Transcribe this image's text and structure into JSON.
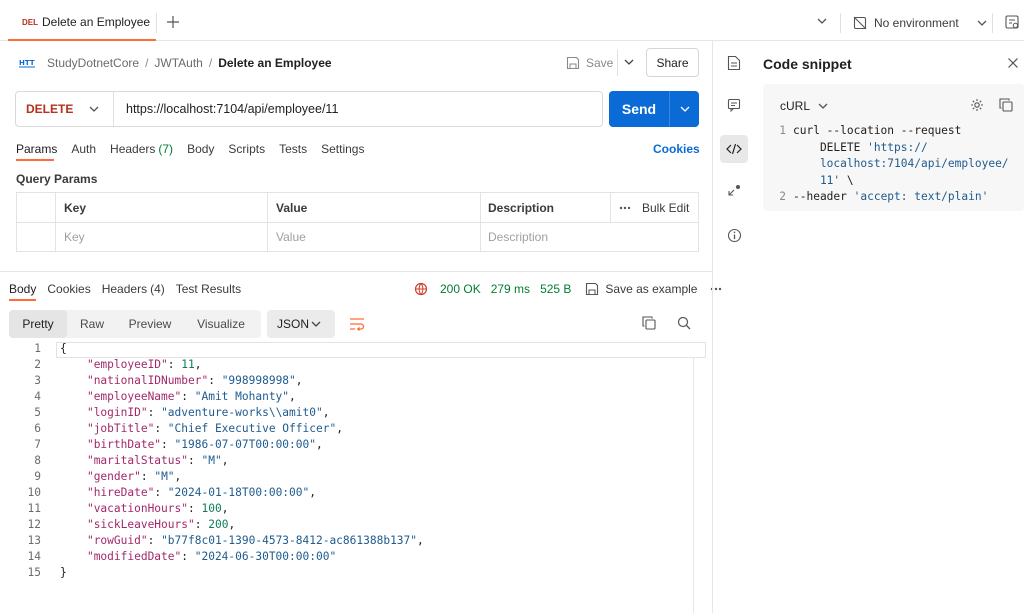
{
  "tab": {
    "method": "DEL",
    "title": "Delete an Employee"
  },
  "environment": {
    "label": "No environment"
  },
  "breadcrumb": {
    "collection": "StudyDotnetCore",
    "folder": "JWTAuth",
    "request": "Delete an Employee"
  },
  "actions": {
    "save": "Save",
    "share": "Share"
  },
  "request": {
    "method": "DELETE",
    "url": "https://localhost:7104/api/employee/11",
    "send": "Send"
  },
  "request_tabs": [
    {
      "label": "Params",
      "count": ""
    },
    {
      "label": "Auth",
      "count": ""
    },
    {
      "label": "Headers",
      "count": "(7)"
    },
    {
      "label": "Body",
      "count": ""
    },
    {
      "label": "Scripts",
      "count": ""
    },
    {
      "label": "Tests",
      "count": ""
    },
    {
      "label": "Settings",
      "count": ""
    }
  ],
  "cookies_link": "Cookies",
  "query_params": {
    "title": "Query Params",
    "headers": {
      "key": "Key",
      "value": "Value",
      "description": "Description",
      "bulk_edit": "Bulk Edit"
    },
    "placeholder": {
      "key": "Key",
      "value": "Value",
      "description": "Description"
    }
  },
  "response_tabs": [
    {
      "label": "Body",
      "count": ""
    },
    {
      "label": "Cookies",
      "count": ""
    },
    {
      "label": "Headers",
      "count": "(4)"
    },
    {
      "label": "Test Results",
      "count": ""
    }
  ],
  "response_meta": {
    "status": "200 OK",
    "time": "279 ms",
    "size": "525 B",
    "save_example": "Save as example"
  },
  "view_modes": [
    "Pretty",
    "Raw",
    "Preview",
    "Visualize"
  ],
  "format": "JSON",
  "response_body": [
    {
      "n": "1",
      "text": "{"
    },
    {
      "n": "2",
      "key": "employeeID",
      "val": "11",
      "kind": "num"
    },
    {
      "n": "3",
      "key": "nationalIDNumber",
      "val": "998998998",
      "kind": "str"
    },
    {
      "n": "4",
      "key": "employeeName",
      "val": "Amit Mohanty",
      "kind": "str"
    },
    {
      "n": "5",
      "key": "loginID",
      "val": "adventure-works\\\\amit0",
      "kind": "str"
    },
    {
      "n": "6",
      "key": "jobTitle",
      "val": "Chief Executive Officer",
      "kind": "str"
    },
    {
      "n": "7",
      "key": "birthDate",
      "val": "1986-07-07T00:00:00",
      "kind": "str"
    },
    {
      "n": "8",
      "key": "maritalStatus",
      "val": "M",
      "kind": "str"
    },
    {
      "n": "9",
      "key": "gender",
      "val": "M",
      "kind": "str"
    },
    {
      "n": "10",
      "key": "hireDate",
      "val": "2024-01-18T00:00:00",
      "kind": "str"
    },
    {
      "n": "11",
      "key": "vacationHours",
      "val": "100",
      "kind": "num"
    },
    {
      "n": "12",
      "key": "sickLeaveHours",
      "val": "200",
      "kind": "num"
    },
    {
      "n": "13",
      "key": "rowGuid",
      "val": "b77f8c01-1390-4573-8412-ac861388b137",
      "kind": "str"
    },
    {
      "n": "14",
      "key": "modifiedDate",
      "val": "2024-06-30T00:00:00",
      "kind": "str",
      "last": true
    },
    {
      "n": "15",
      "text": "}"
    }
  ],
  "code_snippet": {
    "title": "Code snippet",
    "language": "cURL",
    "lines": [
      {
        "n": "1",
        "plain": "curl --location --request"
      },
      {
        "n": "",
        "plain": "    DELETE ",
        "str": "'https://"
      },
      {
        "n": "",
        "str": "    localhost:7104/api/employee/"
      },
      {
        "n": "",
        "str": "    11'",
        "plain_after": " \\"
      },
      {
        "n": "2",
        "plain": "--header ",
        "str": "'accept: text/plain'"
      }
    ]
  },
  "colors": {
    "accent": "#ff6c37",
    "send": "#0b6bd6",
    "status_ok": "#007f31",
    "method_delete": "#b5301d"
  }
}
